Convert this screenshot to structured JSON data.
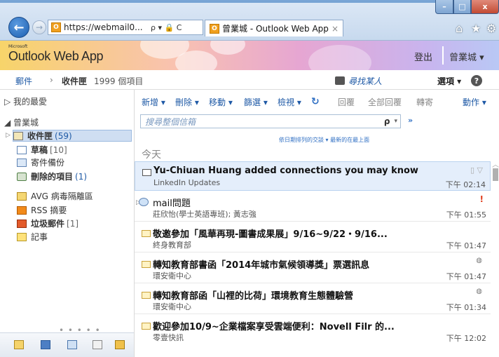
{
  "browser": {
    "url": "https://webmail0...",
    "url_icons": "ρ ▾ 🔒 C",
    "tab_title": "曾業城 - Outlook Web App",
    "favicon_label": "O",
    "back_icon": "←",
    "forward_icon": "→",
    "tab_close_icon": "×",
    "home_icon": "⌂",
    "star_icon": "★",
    "gear_icon": "⚙"
  },
  "window_controls": {
    "minimize": "–",
    "maximize": "□",
    "close": "x"
  },
  "owa": {
    "ms_label": "Microsoft",
    "logo": "Outlook Web App",
    "signout": "登出",
    "user": "曾業城 ▾"
  },
  "breadcrumb": {
    "mail": "郵件",
    "separator": "›",
    "folder": "收件匣",
    "count": "1999 個項目",
    "find_people": "尋找某人",
    "options": "選項 ▾",
    "help": "?"
  },
  "leftnav": {
    "favorites": "▷ 我的最愛",
    "account": "◢ 曾業城",
    "items": [
      {
        "label": "收件匣",
        "count": "(59)",
        "bold": true
      },
      {
        "label": "草稿",
        "count": "[10]",
        "bold": true
      },
      {
        "label": "寄件備份",
        "count": ""
      },
      {
        "label": "刪除的項目",
        "count": "(1)",
        "bold": true
      },
      {
        "label": "AVG 病毒隔離區",
        "count": ""
      },
      {
        "label": "RSS 摘要",
        "count": ""
      },
      {
        "label": "垃圾郵件",
        "count": "[1]",
        "bold": true
      },
      {
        "label": "記事",
        "count": ""
      }
    ],
    "dots": "• • • • •"
  },
  "toolbar": {
    "new": "新增 ▾",
    "delete": "刪除 ▾",
    "move": "移動 ▾",
    "filter": "篩選 ▾",
    "view": "檢視 ▾",
    "refresh": "↻",
    "reply": "回覆",
    "reply_all": "全部回覆",
    "forward": "轉寄",
    "actions": "動作 ▾"
  },
  "search": {
    "placeholder": "搜尋整個信箱",
    "icon": "ρ",
    "dropdown": "▾",
    "expand": "»"
  },
  "list": {
    "arrange_by": "依日期排列的交談 ▾    最新的在最上面",
    "group_today": "今天"
  },
  "messages": [
    {
      "subject": "Yu-Chiuan Huang added connections you may know",
      "from": "LinkedIn Updates",
      "time": "下午 02:14",
      "flag": "▯ ▽",
      "selected": true
    },
    {
      "subject": "mail問題",
      "from": "莊欣怡(學士英語專班); 黃志強",
      "time": "下午 01:55",
      "important": "!"
    },
    {
      "subject": "敬邀參加「風華再現-圖書成果展」9/16~9/22・9/16...",
      "from": "終身教育部",
      "time": "下午 01:47"
    },
    {
      "subject": "轉知教育部書函「2014年城市氣候領導獎」票選訊息",
      "from": "環安衛中心",
      "time": "下午 01:47",
      "attach": "◍"
    },
    {
      "subject": "轉知教育部函「山裡的比荷」環境教育生態體驗營",
      "from": "環安衛中心",
      "time": "下午 01:34",
      "attach": "◍"
    },
    {
      "subject": "歡迎參加10/9~企業檔案享受雲端便利：Novell Filr 的...",
      "from": "零壹快訊",
      "time": "下午 12:02"
    }
  ]
}
